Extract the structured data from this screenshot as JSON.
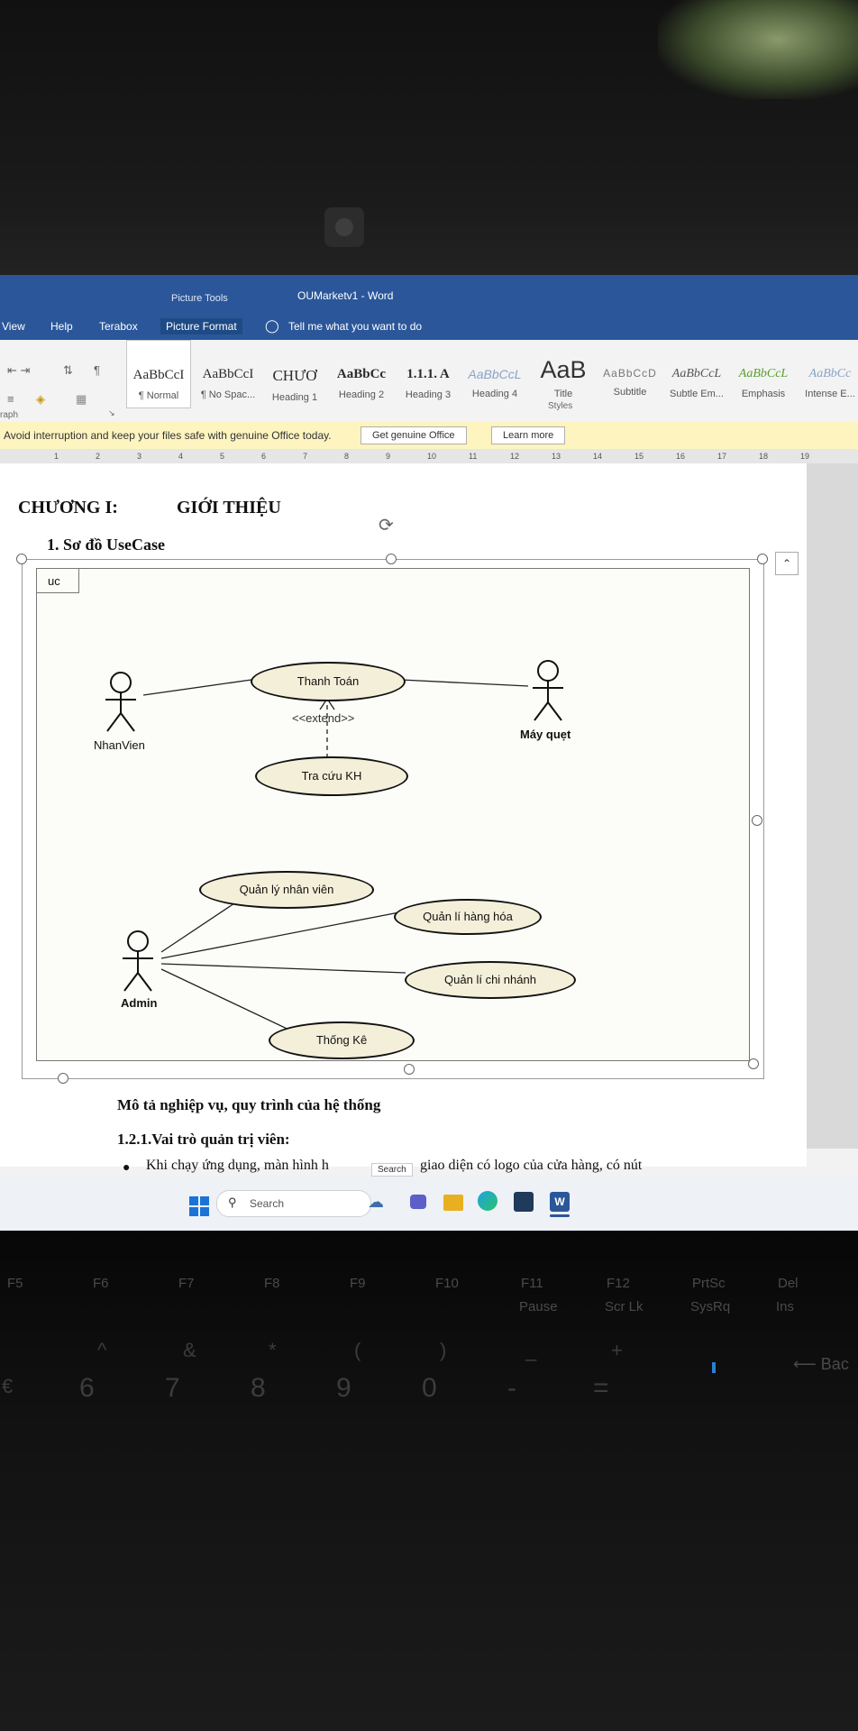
{
  "window": {
    "context_tab_group": "Picture Tools",
    "title": "OUMarketv1  -  Word"
  },
  "tabs": [
    "View",
    "Help",
    "Terabox",
    "Picture Format"
  ],
  "tell_me": "Tell me what you want to do",
  "styles_gallery": {
    "items": [
      {
        "preview": "AaBbCcI",
        "name": "¶ Normal"
      },
      {
        "preview": "AaBbCcI",
        "name": "¶ No Spac..."
      },
      {
        "preview": "CHƯƠ",
        "name": "Heading 1"
      },
      {
        "preview": "AaBbCc",
        "name": "Heading 2"
      },
      {
        "preview": "1.1.1. A",
        "name": "Heading 3"
      },
      {
        "preview": "AaBbCcL",
        "name": "Heading 4"
      },
      {
        "preview": "AaB",
        "name": "Title"
      },
      {
        "preview": "AaBbCcD",
        "name": "Subtitle"
      },
      {
        "preview": "AaBbCcL",
        "name": "Subtle Em..."
      },
      {
        "preview": "AaBbCcL",
        "name": "Emphasis"
      },
      {
        "preview": "AaBbCc",
        "name": "Intense E..."
      }
    ],
    "group_label": "Styles",
    "paragraph_label": "raph"
  },
  "message_bar": {
    "text": "Avoid interruption and keep your files safe with genuine Office today.",
    "button_primary": "Get genuine Office",
    "button_secondary": "Learn more"
  },
  "ruler_numbers": [
    "1",
    "2",
    "3",
    "4",
    "5",
    "6",
    "7",
    "8",
    "9",
    "10",
    "11",
    "12",
    "13",
    "14",
    "15",
    "16",
    "17",
    "18",
    "19"
  ],
  "document": {
    "chapter_label": "CHƯƠNG I:",
    "chapter_title": "GIỚI THIỆU",
    "section_heading": "1.  Sơ đồ UseCase",
    "diagram_tag": "uc",
    "after_diagram_heading": "Mô tả nghiệp vụ, quy trình của hệ thống",
    "subheading": "1.2.1.Vai trò quản trị viên:",
    "bullet_text_left": "Khi chạy ứng dụng, màn hình h",
    "bullet_text_right": "giao diện có logo của cửa hàng, có nút",
    "tooltip": "Search"
  },
  "usecase_diagram": {
    "actors": [
      "NhanVien",
      "Máy quẹt",
      "Admin"
    ],
    "use_cases": [
      "Thanh Toán",
      "Tra cứu KH",
      "Quản lý nhân viên",
      "Quản lí hàng hóa",
      "Quản lí chi nhánh",
      "Thống Kê"
    ],
    "relation_label": "<<extend>>"
  },
  "taskbar": {
    "search_placeholder": "Search"
  },
  "keyboard": {
    "fkeys": [
      "F5",
      "F6",
      "F7",
      "F8",
      "F9",
      "F10",
      "F11",
      "F12",
      "PrtSc",
      "Del"
    ],
    "fkey_sub": [
      "",
      "",
      "",
      "",
      "",
      "",
      "Pause",
      "Scr Lk",
      "SysRq",
      "Ins"
    ],
    "number_row": [
      "6",
      "7",
      "8",
      "9",
      "0",
      "-",
      "="
    ],
    "symbol_row": [
      "^",
      "&",
      "*",
      "(",
      ")",
      "_",
      "+"
    ],
    "backspace": "⟵ Bac",
    "left_edge": "€"
  },
  "colors": {
    "word_blue": "#2b579a",
    "usecase_fill": "#f3efd9",
    "message_bar": "#fdf4c0"
  }
}
